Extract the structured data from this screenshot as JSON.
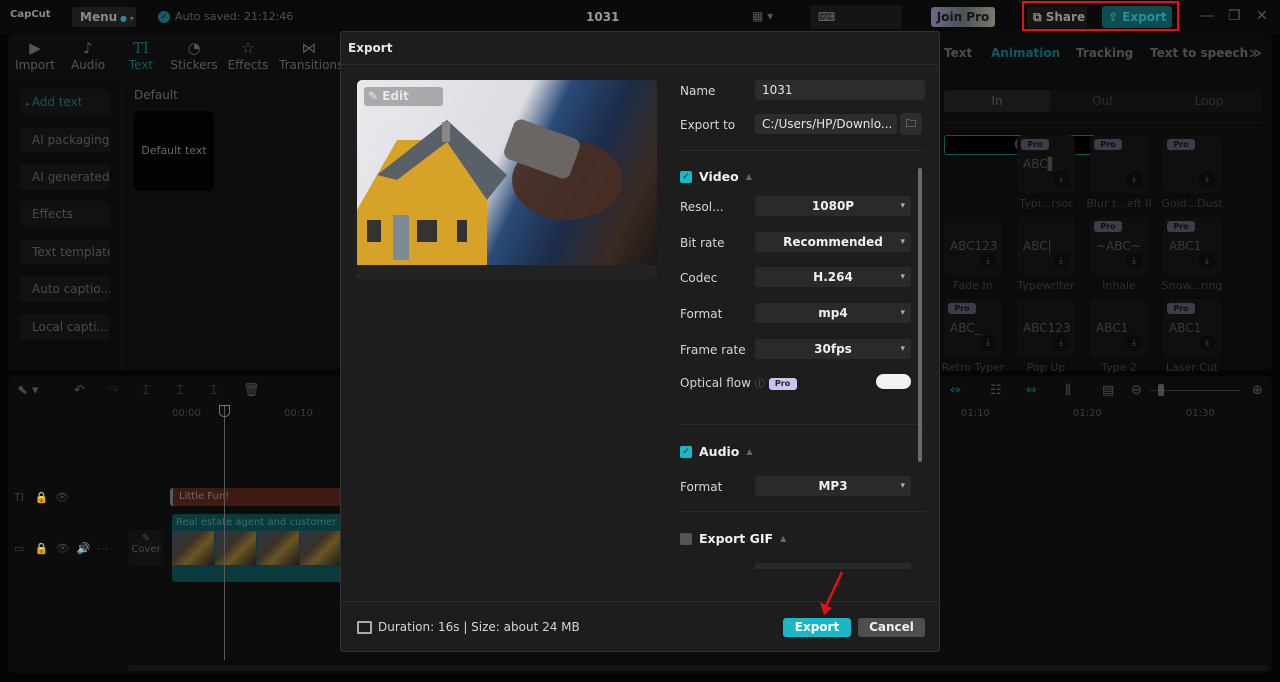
{
  "app": {
    "logo": "CapCut",
    "menu_label": "Menu",
    "autosave": "Auto saved: 21:12:46",
    "title": "1031",
    "shortcuts_label": "Shortcuts",
    "join_pro_label": "Join Pro",
    "share_label": "Share",
    "export_label": "Export",
    "accent_color": "#19b8c6",
    "highlight_box_color": "#e0121a"
  },
  "toolbar": {
    "items": [
      {
        "label": "Import",
        "icon": "import-icon"
      },
      {
        "label": "Audio",
        "icon": "audio-icon"
      },
      {
        "label": "Text",
        "icon": "text-icon",
        "active": true
      },
      {
        "label": "Stickers",
        "icon": "stickers-icon"
      },
      {
        "label": "Effects",
        "icon": "effects-icon"
      },
      {
        "label": "Transitions",
        "icon": "transitions-icon"
      }
    ]
  },
  "sidebar": {
    "items": [
      {
        "label": "Add text",
        "active": true
      },
      {
        "label": "AI packaging"
      },
      {
        "label": "AI generated"
      },
      {
        "label": "Effects"
      },
      {
        "label": "Text template"
      },
      {
        "label": "Auto captio..."
      },
      {
        "label": "Local capti..."
      }
    ]
  },
  "library": {
    "section_label": "Default",
    "card_label": "Default text"
  },
  "right_panel": {
    "tabs": [
      "Text",
      "Animation",
      "Tracking",
      "Text to speech"
    ],
    "active_tab": "Animation",
    "segments": [
      "In",
      "Out",
      "Loop"
    ],
    "active_segment": "In",
    "animations": [
      {
        "label": "",
        "preview": "",
        "pro": false,
        "selected": true
      },
      {
        "label": "Typi...rsor",
        "preview": "ABC▌",
        "pro": true
      },
      {
        "label": "Blur t...eft II",
        "preview": "",
        "pro": true
      },
      {
        "label": "Gold...Dust",
        "preview": "",
        "pro": true
      },
      {
        "label": "Fade In",
        "preview": "ABC123",
        "pro": false
      },
      {
        "label": "Typewriter",
        "preview": "ABC|",
        "pro": false
      },
      {
        "label": "Inhale",
        "preview": "~ABC~",
        "pro": true
      },
      {
        "label": "Snow...ring",
        "preview": "ABC1",
        "pro": true
      },
      {
        "label": "Retro Typer",
        "preview": "ABC_",
        "pro": true
      },
      {
        "label": "Pop Up",
        "preview": "ABC123",
        "pro": false
      },
      {
        "label": "Type 2",
        "preview": "ABC1",
        "pro": false
      },
      {
        "label": "Laser Cut",
        "preview": "ABC1",
        "pro": true
      }
    ]
  },
  "timeline": {
    "ruler_left": [
      "00:00",
      "00:10"
    ],
    "ruler_right": [
      "01:10",
      "01:20",
      "01:30"
    ],
    "text_clip": "Little Fun!",
    "video_clip": "Real estate agent and customer si",
    "cover_label": "Cover"
  },
  "export_dialog": {
    "title": "Export",
    "edit_cover_label": "Edit cover",
    "name_label": "Name",
    "name_value": "1031",
    "export_to_label": "Export to",
    "export_to_value": "C:/Users/HP/Downlo...",
    "video": {
      "label": "Video",
      "checked": true,
      "fields": [
        {
          "label": "Resol...",
          "value": "1080P"
        },
        {
          "label": "Bit rate",
          "value": "Recommended"
        },
        {
          "label": "Codec",
          "value": "H.264"
        },
        {
          "label": "Format",
          "value": "mp4"
        },
        {
          "label": "Frame rate",
          "value": "30fps"
        }
      ],
      "optical_flow_label": "Optical flow",
      "optical_flow_badge": "Pro",
      "optical_flow_on": false
    },
    "audio": {
      "label": "Audio",
      "checked": true,
      "format_label": "Format",
      "format_value": "MP3"
    },
    "gif": {
      "label": "Export GIF",
      "checked": false
    },
    "footer_info": "Duration: 16s | Size: about 24 MB",
    "export_button": "Export",
    "cancel_button": "Cancel"
  }
}
